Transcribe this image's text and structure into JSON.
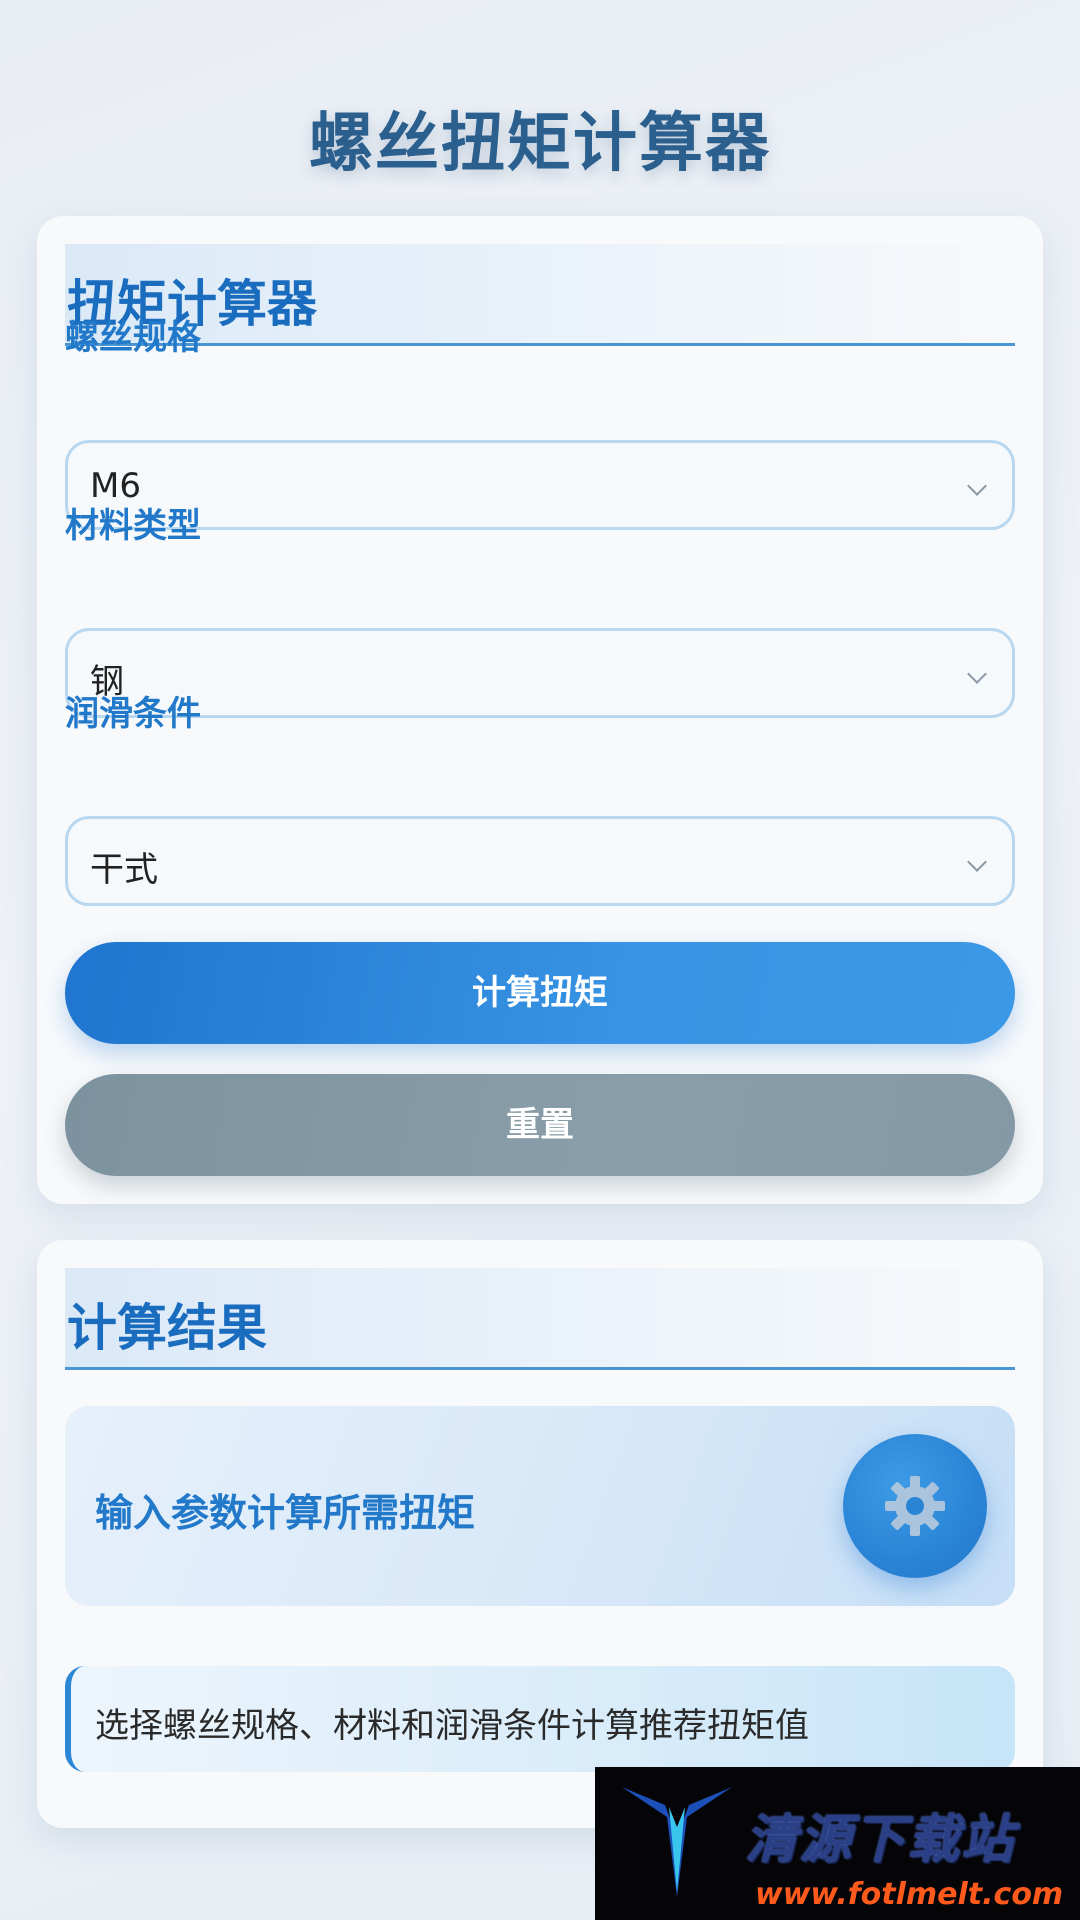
{
  "page": {
    "title": "螺丝扭矩计算器"
  },
  "calculator": {
    "header": "扭矩计算器",
    "fields": [
      {
        "label": "螺丝规格",
        "value": "M6"
      },
      {
        "label": "材料类型",
        "value": "钢"
      },
      {
        "label": "润滑条件",
        "value": "干式"
      }
    ],
    "calculate_label": "计算扭矩",
    "reset_label": "重置"
  },
  "result": {
    "header": "计算结果",
    "prompt": "输入参数计算所需扭矩",
    "icon": "gear-icon",
    "hint": "选择螺丝规格、材料和润滑条件计算推荐扭矩值"
  },
  "watermark": {
    "name": "清源下载站",
    "url": "www.fotlmelt.com"
  },
  "colors": {
    "accent": "#1a6cbf",
    "primary_button": "#2a87d9",
    "reset_button": "#8499a5",
    "watermark_url": "#ff5a1c"
  }
}
